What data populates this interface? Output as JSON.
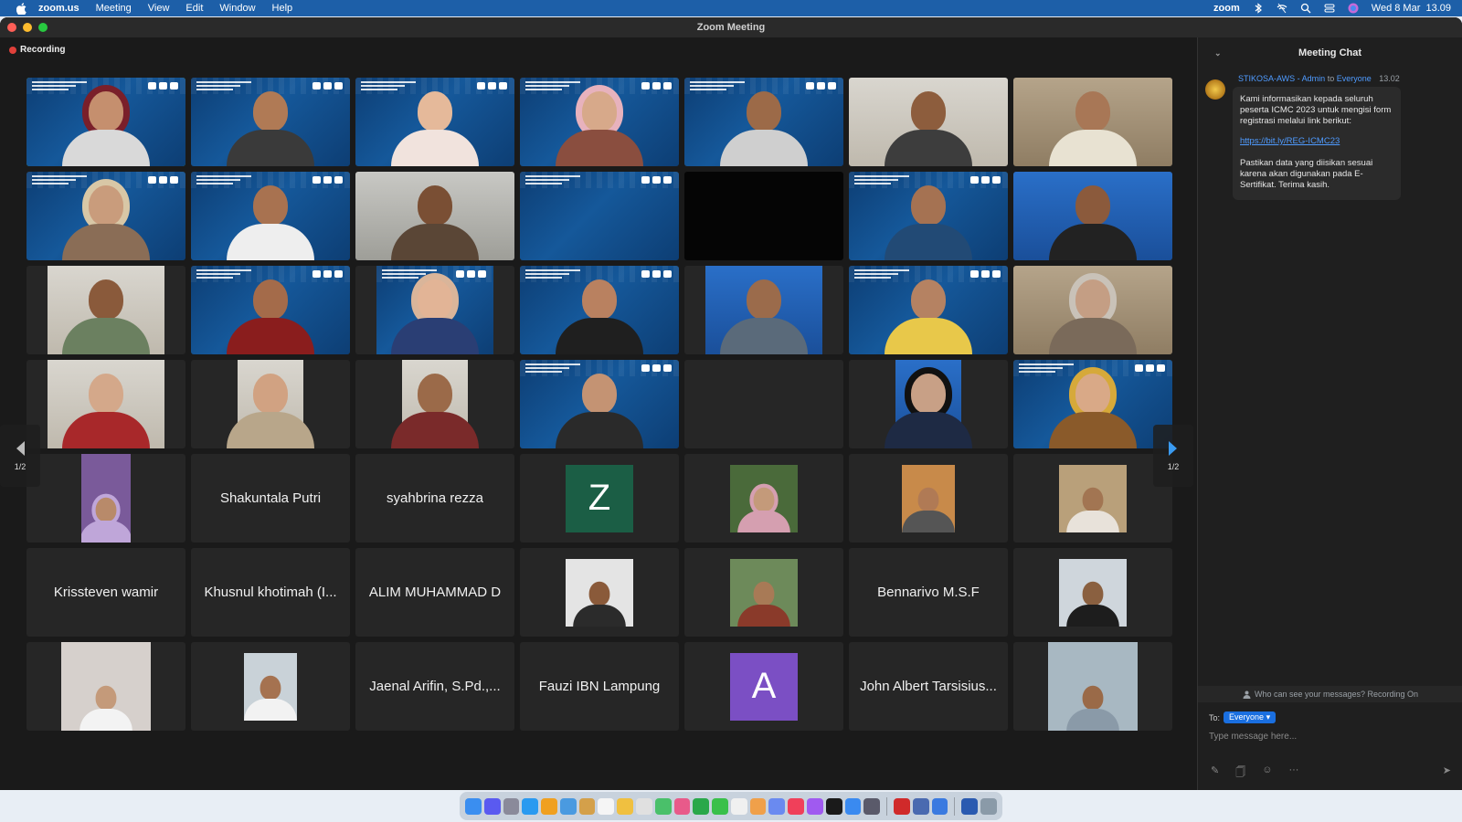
{
  "menubar": {
    "app_name": "zoom.us",
    "menus": [
      "Meeting",
      "View",
      "Edit",
      "Window",
      "Help"
    ],
    "right_brand": "zoom",
    "datetime": "Wed 8 Mar  13.09"
  },
  "window": {
    "title": "Zoom Meeting",
    "recording_label": "Recording"
  },
  "gallery": {
    "page_indicator_left": "1/2",
    "page_indicator_right": "1/2",
    "tiles": [
      {
        "kind": "video",
        "bg": "conf",
        "skin": "#c58f6e",
        "shirt": "#d9d9d9",
        "hijab": "#7a1f2a",
        "active": true
      },
      {
        "kind": "video",
        "bg": "conf",
        "skin": "#b07a55",
        "shirt": "#3a3a3a"
      },
      {
        "kind": "video",
        "bg": "conf",
        "skin": "#e5b99a",
        "shirt": "#f1e3dd"
      },
      {
        "kind": "video",
        "bg": "conf",
        "skin": "#d7a98a",
        "shirt": "#8a4e3f",
        "hijab": "#e7b2bd"
      },
      {
        "kind": "video",
        "bg": "conf",
        "skin": "#9c6a48",
        "shirt": "#cfcfcf"
      },
      {
        "kind": "video",
        "bg": "room",
        "skin": "#8d5d3d",
        "shirt": "#3d3d3d"
      },
      {
        "kind": "video",
        "bg": "shelf",
        "skin": "#a87756",
        "shirt": "#e8e2d2"
      },
      {
        "kind": "video",
        "bg": "conf",
        "skin": "#c99c7c",
        "shirt": "#8a6d56",
        "hijab": "#d8c7a6"
      },
      {
        "kind": "video",
        "bg": "conf",
        "skin": "#a87250",
        "shirt": "#eeeeee"
      },
      {
        "kind": "video",
        "bg": "gray",
        "skin": "#7a4f34",
        "shirt": "#5a4636"
      },
      {
        "kind": "video",
        "bg": "conf",
        "empty": true
      },
      {
        "kind": "video",
        "bg": "dark",
        "empty": true
      },
      {
        "kind": "video",
        "bg": "conf",
        "skin": "#a57252",
        "shirt": "#224a75"
      },
      {
        "kind": "video",
        "bg": "blue-wall",
        "skin": "#8b5a3c",
        "shirt": "#222222"
      },
      {
        "kind": "video",
        "bg": "room",
        "skin": "#8a5a3b",
        "shirt": "#6b8060",
        "narrow": 128
      },
      {
        "kind": "video",
        "bg": "conf",
        "skin": "#a46b4a",
        "shirt": "#8a1d1d"
      },
      {
        "kind": "video",
        "bg": "conf",
        "skin": "#e2b496",
        "shirt": "#2a3e74",
        "narrow": 128,
        "hijab": "#d9b59a"
      },
      {
        "kind": "video",
        "bg": "conf",
        "skin": "#b98160",
        "shirt": "#1f1f1f"
      },
      {
        "kind": "video",
        "bg": "blue-wall",
        "skin": "#9b6b4b",
        "shirt": "#5a6a7a",
        "narrow": 128
      },
      {
        "kind": "video",
        "bg": "conf",
        "skin": "#b58262",
        "shirt": "#e8c84a"
      },
      {
        "kind": "video",
        "bg": "shelf",
        "skin": "#c49e84",
        "shirt": "#7a6a5a",
        "hijab": "#c9c2b8"
      },
      {
        "kind": "video",
        "bg": "room",
        "skin": "#d4a88a",
        "shirt": "#a8282a",
        "narrow": 128
      },
      {
        "kind": "video",
        "bg": "room",
        "skin": "#d1a282",
        "shirt": "#b8a68a",
        "narrow": 72
      },
      {
        "kind": "video",
        "bg": "room",
        "skin": "#9b6a49",
        "shirt": "#7a2a2a",
        "narrow": 72
      },
      {
        "kind": "video",
        "bg": "conf",
        "skin": "#c49373",
        "shirt": "#2a2a2a"
      },
      {
        "kind": "empty"
      },
      {
        "kind": "video",
        "bg": "blue-wall",
        "skin": "#c8a086",
        "shirt": "#1e2a44",
        "narrow": 72,
        "hijab": "#111111"
      },
      {
        "kind": "video",
        "bg": "conf",
        "skin": "#d9a987",
        "shirt": "#8a5a2a",
        "hijab": "#d6a93a"
      },
      {
        "kind": "photo",
        "bg": "#7a5a9a",
        "skin": "#b88a6a",
        "hijab": "#bfa6d9",
        "narrow": 54
      },
      {
        "kind": "name",
        "name": "Shakuntala Putri"
      },
      {
        "kind": "name",
        "name": "syahbrina rezza"
      },
      {
        "kind": "letter",
        "letter": "Z",
        "bg": "#1b5e45"
      },
      {
        "kind": "photo",
        "bg": "#4a6a3a",
        "skin": "#c49a7a",
        "hijab": "#d59fb0",
        "narrow": 74
      },
      {
        "kind": "photo",
        "bg": "#c88a4a",
        "skin": "#b07a55",
        "narrow": 58
      },
      {
        "kind": "photo",
        "bg": "#b9a07a",
        "skin": "#a27552",
        "shirt": "#e8e2da",
        "narrow": 74
      },
      {
        "kind": "name",
        "name": "Krissteven wamir"
      },
      {
        "kind": "name",
        "name": "Khusnul khotimah (I..."
      },
      {
        "kind": "name",
        "name": "ALIM MUHAMMAD D"
      },
      {
        "kind": "photo",
        "bg": "#e4e4e4",
        "skin": "#8a5a3a",
        "shirt": "#2b2b2b",
        "narrow": 74
      },
      {
        "kind": "photo",
        "bg": "#6d8a5a",
        "skin": "#a87a56",
        "shirt": "#8a3a2a",
        "narrow": 74
      },
      {
        "kind": "name",
        "name": "Bennarivo M.S.F"
      },
      {
        "kind": "photo",
        "bg": "#cfd6dc",
        "skin": "#8a6040",
        "shirt": "#1d1d1d",
        "narrow": 74
      },
      {
        "kind": "photo",
        "bg": "#d6d0cc",
        "skin": "#c49a7a",
        "shirt": "#f3f3f3",
        "narrow": 98
      },
      {
        "kind": "photo",
        "bg": "#c9d2d8",
        "skin": "#a57250",
        "shirt": "#f2f2f2",
        "narrow": 58
      },
      {
        "kind": "name",
        "name": "Jaenal Arifin, S.Pd.,..."
      },
      {
        "kind": "name",
        "name": "Fauzi IBN Lampung"
      },
      {
        "kind": "letter",
        "letter": "A",
        "bg": "#7b4fc4"
      },
      {
        "kind": "name",
        "name": "John Albert Tarsisius..."
      },
      {
        "kind": "photo",
        "bg": "#a8b8c2",
        "skin": "#9a6a48",
        "shirt": "#8a9aa8",
        "narrow": 98
      }
    ]
  },
  "chat": {
    "title": "Meeting Chat",
    "message": {
      "sender": "STIKOSA-AWS - Admin",
      "to_word": "to",
      "recipient": "Everyone",
      "time": "13.02",
      "text_1": "Kami informasikan kepada seluruh peserta ICMC 2023 untuk mengisi form registrasi melalui link berikut:",
      "link": "https://bit.ly/REG-ICMC23",
      "text_2": "Pastikan data yang diisikan sesuai karena akan digunakan pada E-Sertifikat. Terima kasih."
    },
    "privacy_notice": "Who can see your messages? Recording On",
    "to_label": "To:",
    "to_value": "Everyone",
    "input_placeholder": "Type message here..."
  },
  "dock": {
    "apps": [
      "#3a8ef0",
      "#5a5af0",
      "#8a8a9a",
      "#2a9af0",
      "#f0a020",
      "#4a9ae0",
      "#d4a04a",
      "#f5f5f5",
      "#f0c040",
      "#e0e0e0",
      "#4ac06a",
      "#e85a8a",
      "#2aa84a",
      "#3ac04a",
      "#f0f0f0",
      "#f0a04a",
      "#6a8af0",
      "#f0405a",
      "#a05af0",
      "#1a1a1a",
      "#3a8af0",
      "#5a5a6a",
      "#d02a2a",
      "#4a6ab0",
      "#3a7ae0",
      "#2a5ab0",
      "#8a9aa8"
    ]
  }
}
